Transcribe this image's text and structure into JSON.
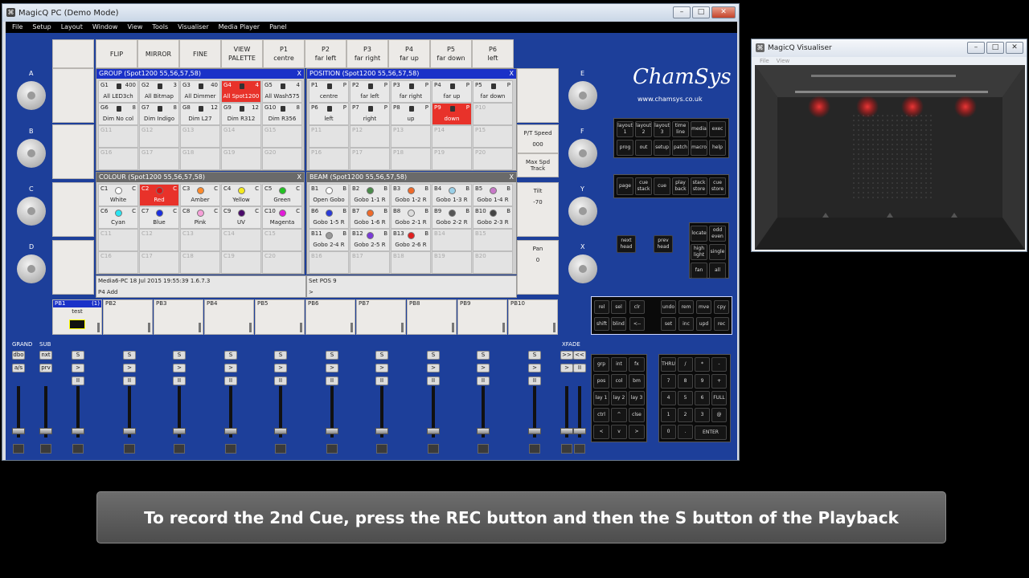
{
  "main_window": {
    "title": "MagicQ PC (Demo Mode)",
    "menu": [
      "File",
      "Setup",
      "Layout",
      "Window",
      "View",
      "Tools",
      "Visualiser",
      "Media Player",
      "Panel"
    ]
  },
  "top_buttons": [
    {
      "l1": "",
      "l2": ""
    },
    {
      "l1": "FLIP",
      "l2": ""
    },
    {
      "l1": "MIRROR",
      "l2": ""
    },
    {
      "l1": "FINE",
      "l2": ""
    },
    {
      "l1": "VIEW",
      "l2": "PALETTE"
    },
    {
      "l1": "P1",
      "l2": "centre"
    },
    {
      "l1": "P2",
      "l2": "far left"
    },
    {
      "l1": "P3",
      "l2": "far right"
    },
    {
      "l1": "P4",
      "l2": "far up"
    },
    {
      "l1": "P5",
      "l2": "far down"
    },
    {
      "l1": "P6",
      "l2": "left"
    }
  ],
  "encoders": {
    "left": [
      "A",
      "B",
      "C",
      "D"
    ],
    "right": [
      "E",
      "F",
      "Y",
      "X"
    ]
  },
  "group_window": {
    "title": "GROUP (Spot1200 55,56,57,58)",
    "cells": [
      {
        "id": "G1",
        "n": "400",
        "label": "All LED3ch"
      },
      {
        "id": "G2",
        "n": "3",
        "label": "All Bitmap"
      },
      {
        "id": "G3",
        "n": "40",
        "label": "All Dimmer"
      },
      {
        "id": "G4",
        "n": "4",
        "label": "All Spot1200"
      },
      {
        "id": "G5",
        "n": "4",
        "label": "All Wash575"
      },
      {
        "id": "G6",
        "n": "8",
        "label": "Dim No col"
      },
      {
        "id": "G7",
        "n": "8",
        "label": "Dim Indigo"
      },
      {
        "id": "G8",
        "n": "12",
        "label": "Dim L27"
      },
      {
        "id": "G9",
        "n": "12",
        "label": "Dim R312"
      },
      {
        "id": "G10",
        "n": "8",
        "label": "Dim R356"
      },
      {
        "id": "G11",
        "n": "",
        "label": ""
      },
      {
        "id": "G12",
        "n": "",
        "label": ""
      },
      {
        "id": "G13",
        "n": "",
        "label": ""
      },
      {
        "id": "G14",
        "n": "",
        "label": ""
      },
      {
        "id": "G15",
        "n": "",
        "label": ""
      },
      {
        "id": "G16",
        "n": "",
        "label": ""
      },
      {
        "id": "G17",
        "n": "",
        "label": ""
      },
      {
        "id": "G18",
        "n": "",
        "label": ""
      },
      {
        "id": "G19",
        "n": "",
        "label": ""
      },
      {
        "id": "G20",
        "n": "",
        "label": ""
      }
    ]
  },
  "position_window": {
    "title": "POSITION (Spot1200 55,56,57,58)",
    "cells": [
      {
        "id": "P1",
        "n": "P",
        "label": "centre"
      },
      {
        "id": "P2",
        "n": "P",
        "label": "far left"
      },
      {
        "id": "P3",
        "n": "P",
        "label": "far right"
      },
      {
        "id": "P4",
        "n": "P",
        "label": "far up"
      },
      {
        "id": "P5",
        "n": "P",
        "label": "far down"
      },
      {
        "id": "P6",
        "n": "P",
        "label": "left"
      },
      {
        "id": "P7",
        "n": "P",
        "label": "right"
      },
      {
        "id": "P8",
        "n": "P",
        "label": "up"
      },
      {
        "id": "P9",
        "n": "P",
        "label": "down"
      },
      {
        "id": "P10",
        "n": "",
        "label": ""
      },
      {
        "id": "P11",
        "n": "",
        "label": ""
      },
      {
        "id": "P12",
        "n": "",
        "label": ""
      },
      {
        "id": "P13",
        "n": "",
        "label": ""
      },
      {
        "id": "P14",
        "n": "",
        "label": ""
      },
      {
        "id": "P15",
        "n": "",
        "label": ""
      },
      {
        "id": "P16",
        "n": "",
        "label": ""
      },
      {
        "id": "P17",
        "n": "",
        "label": ""
      },
      {
        "id": "P18",
        "n": "",
        "label": ""
      },
      {
        "id": "P19",
        "n": "",
        "label": ""
      },
      {
        "id": "P20",
        "n": "",
        "label": ""
      }
    ]
  },
  "colour_window": {
    "title": "COLOUR (Spot1200 55,56,57,58)",
    "cells": [
      {
        "id": "C1",
        "n": "C",
        "label": "White",
        "color": "#ffffff"
      },
      {
        "id": "C2",
        "n": "C",
        "label": "Red",
        "color": "#e01010"
      },
      {
        "id": "C3",
        "n": "C",
        "label": "Amber",
        "color": "#ff8a2a"
      },
      {
        "id": "C4",
        "n": "C",
        "label": "Yellow",
        "color": "#f4ea1c"
      },
      {
        "id": "C5",
        "n": "C",
        "label": "Green",
        "color": "#22c322"
      },
      {
        "id": "C6",
        "n": "C",
        "label": "Cyan",
        "color": "#29e4f2"
      },
      {
        "id": "C7",
        "n": "C",
        "label": "Blue",
        "color": "#1a2ee0"
      },
      {
        "id": "C8",
        "n": "C",
        "label": "Pink",
        "color": "#f6a0d8"
      },
      {
        "id": "C9",
        "n": "C",
        "label": "UV",
        "color": "#4a0a6a"
      },
      {
        "id": "C10",
        "n": "C",
        "label": "Magenta",
        "color": "#e21ad8"
      },
      {
        "id": "C11",
        "n": "",
        "label": "",
        "color": ""
      },
      {
        "id": "C12",
        "n": "",
        "label": "",
        "color": ""
      },
      {
        "id": "C13",
        "n": "",
        "label": "",
        "color": ""
      },
      {
        "id": "C14",
        "n": "",
        "label": "",
        "color": ""
      },
      {
        "id": "C15",
        "n": "",
        "label": "",
        "color": ""
      },
      {
        "id": "C16",
        "n": "",
        "label": "",
        "color": ""
      },
      {
        "id": "C17",
        "n": "",
        "label": "",
        "color": ""
      },
      {
        "id": "C18",
        "n": "",
        "label": "",
        "color": ""
      },
      {
        "id": "C19",
        "n": "",
        "label": "",
        "color": ""
      },
      {
        "id": "C20",
        "n": "",
        "label": "",
        "color": ""
      }
    ]
  },
  "beam_window": {
    "title": "BEAM (Spot1200 55,56,57,58)",
    "cells": [
      {
        "id": "B1",
        "n": "B",
        "label": "Open Gobo",
        "color": "#ffffff"
      },
      {
        "id": "B2",
        "n": "B",
        "label": "Gobo 1-1 R",
        "color": "#4a8a4a"
      },
      {
        "id": "B3",
        "n": "B",
        "label": "Gobo 1-2 R",
        "color": "#ef6a2a"
      },
      {
        "id": "B4",
        "n": "B",
        "label": "Gobo 1-3 R",
        "color": "#9ad0e8"
      },
      {
        "id": "B5",
        "n": "B",
        "label": "Gobo 1-4 R",
        "color": "#c878c8"
      },
      {
        "id": "B6",
        "n": "B",
        "label": "Gobo 1-5 R",
        "color": "#2a3ad8"
      },
      {
        "id": "B7",
        "n": "B",
        "label": "Gobo 1-6 R",
        "color": "#ef6a2a"
      },
      {
        "id": "B8",
        "n": "B",
        "label": "Gobo 2-1 R",
        "color": "#dddddd"
      },
      {
        "id": "B9",
        "n": "B",
        "label": "Gobo 2-2 R",
        "color": "#555555"
      },
      {
        "id": "B10",
        "n": "B",
        "label": "Gobo 2-3 R",
        "color": "#444444"
      },
      {
        "id": "B11",
        "n": "B",
        "label": "Gobo 2-4 R",
        "color": "#999999"
      },
      {
        "id": "B12",
        "n": "B",
        "label": "Gobo 2-5 R",
        "color": "#7a3ad8"
      },
      {
        "id": "B13",
        "n": "B",
        "label": "Gobo 2-6 R",
        "color": "#e02020"
      },
      {
        "id": "B14",
        "n": "",
        "label": "",
        "color": ""
      },
      {
        "id": "B15",
        "n": "",
        "label": "",
        "color": ""
      },
      {
        "id": "B16",
        "n": "",
        "label": "",
        "color": ""
      },
      {
        "id": "B17",
        "n": "",
        "label": "",
        "color": ""
      },
      {
        "id": "B18",
        "n": "",
        "label": "",
        "color": ""
      },
      {
        "id": "B19",
        "n": "",
        "label": "",
        "color": ""
      },
      {
        "id": "B20",
        "n": "",
        "label": "",
        "color": ""
      }
    ]
  },
  "status": {
    "left_line1": "Media6-PC 18 Jul 2015 19:55:39 1.6.7.3",
    "left_line2": "P4  Add",
    "right_line1": "Set POS 9",
    "right_line2": ">"
  },
  "right_soft": [
    {
      "l1": "",
      "l2": ""
    },
    {
      "l1": "P/T Speed",
      "l2": "000"
    },
    {
      "l1": "Max Spd Track",
      "l2": ""
    },
    {
      "l1": "Tilt",
      "l2": "-70"
    },
    {
      "l1": "Pan",
      "l2": "0"
    }
  ],
  "playbacks": [
    {
      "name": "PB1",
      "num": "(1)",
      "cue": "test"
    },
    {
      "name": "PB2",
      "num": "",
      "cue": ""
    },
    {
      "name": "PB3",
      "num": "",
      "cue": ""
    },
    {
      "name": "PB4",
      "num": "",
      "cue": ""
    },
    {
      "name": "PB5",
      "num": "",
      "cue": ""
    },
    {
      "name": "PB6",
      "num": "",
      "cue": ""
    },
    {
      "name": "PB7",
      "num": "",
      "cue": ""
    },
    {
      "name": "PB8",
      "num": "",
      "cue": ""
    },
    {
      "name": "PB9",
      "num": "",
      "cue": ""
    },
    {
      "name": "PB10",
      "num": "",
      "cue": ""
    }
  ],
  "faders": {
    "grand": "GRAND",
    "sub": "SUB",
    "xfade": "XFADE",
    "grand_btns": [
      "dbo",
      "a/s"
    ],
    "sub_btns": [
      "nxt",
      "prv"
    ],
    "s": "S",
    "go": ">",
    "pause": "II",
    "xfade_btns": [
      ">>",
      "<<"
    ]
  },
  "brand": {
    "name": "ChamSys",
    "url": "www.chamsys.co.uk"
  },
  "keys": {
    "row1": [
      {
        "k": "layout\n1"
      },
      {
        "k": "layout\n2"
      },
      {
        "k": "layout\n3"
      },
      {
        "k": "time\nline"
      },
      {
        "k": "media"
      },
      {
        "k": "exec"
      }
    ],
    "row2": [
      {
        "k": "prog"
      },
      {
        "k": "out"
      },
      {
        "k": "setup"
      },
      {
        "k": "patch"
      },
      {
        "k": "macro"
      },
      {
        "k": "help"
      }
    ],
    "row3": [
      {
        "k": "page"
      },
      {
        "k": "cue\nstack"
      },
      {
        "k": "cue"
      },
      {
        "k": "play\nback"
      },
      {
        "k": "stack\nstore"
      },
      {
        "k": "cue\nstore"
      }
    ],
    "next_head": "next\nhead",
    "prev_head": "prev\nhead",
    "locate_block": [
      {
        "k": "locate"
      },
      {
        "k": "odd\neven"
      },
      {
        "k": "high\nlight"
      },
      {
        "k": "single"
      },
      {
        "k": "fan"
      },
      {
        "k": "all"
      }
    ],
    "edit_row1": [
      {
        "k": "rel"
      },
      {
        "k": "sel"
      },
      {
        "k": "clr"
      },
      {
        "k": "undo"
      },
      {
        "k": "rem"
      },
      {
        "k": "mve"
      },
      {
        "k": "cpy"
      }
    ],
    "edit_row2": [
      {
        "k": "shift"
      },
      {
        "k": "blind"
      },
      {
        "k": "<--"
      },
      {
        "k": "set"
      },
      {
        "k": "inc"
      },
      {
        "k": "upd"
      },
      {
        "k": "rec"
      }
    ],
    "fn_block": [
      [
        "grp",
        "int",
        "fx"
      ],
      [
        "pos",
        "col",
        "bm"
      ],
      [
        "lay 1",
        "lay 2",
        "lay 3"
      ],
      [
        "ctrl",
        "^",
        "clse"
      ],
      [
        "<",
        "v",
        ">"
      ]
    ],
    "num_block": [
      [
        "THRU",
        "/",
        "*",
        "-"
      ],
      [
        "7",
        "8",
        "9",
        "+"
      ],
      [
        "4",
        "5",
        "6",
        "FULL"
      ],
      [
        "1",
        "2",
        "3",
        "@"
      ],
      [
        "0",
        ".",
        "ENTER",
        ""
      ]
    ]
  },
  "visualiser": {
    "title": "MagicQ Visualiser",
    "menu": [
      "File",
      "View"
    ]
  },
  "caption": "To record the 2nd Cue, press the REC button and then the S button of the Playback"
}
